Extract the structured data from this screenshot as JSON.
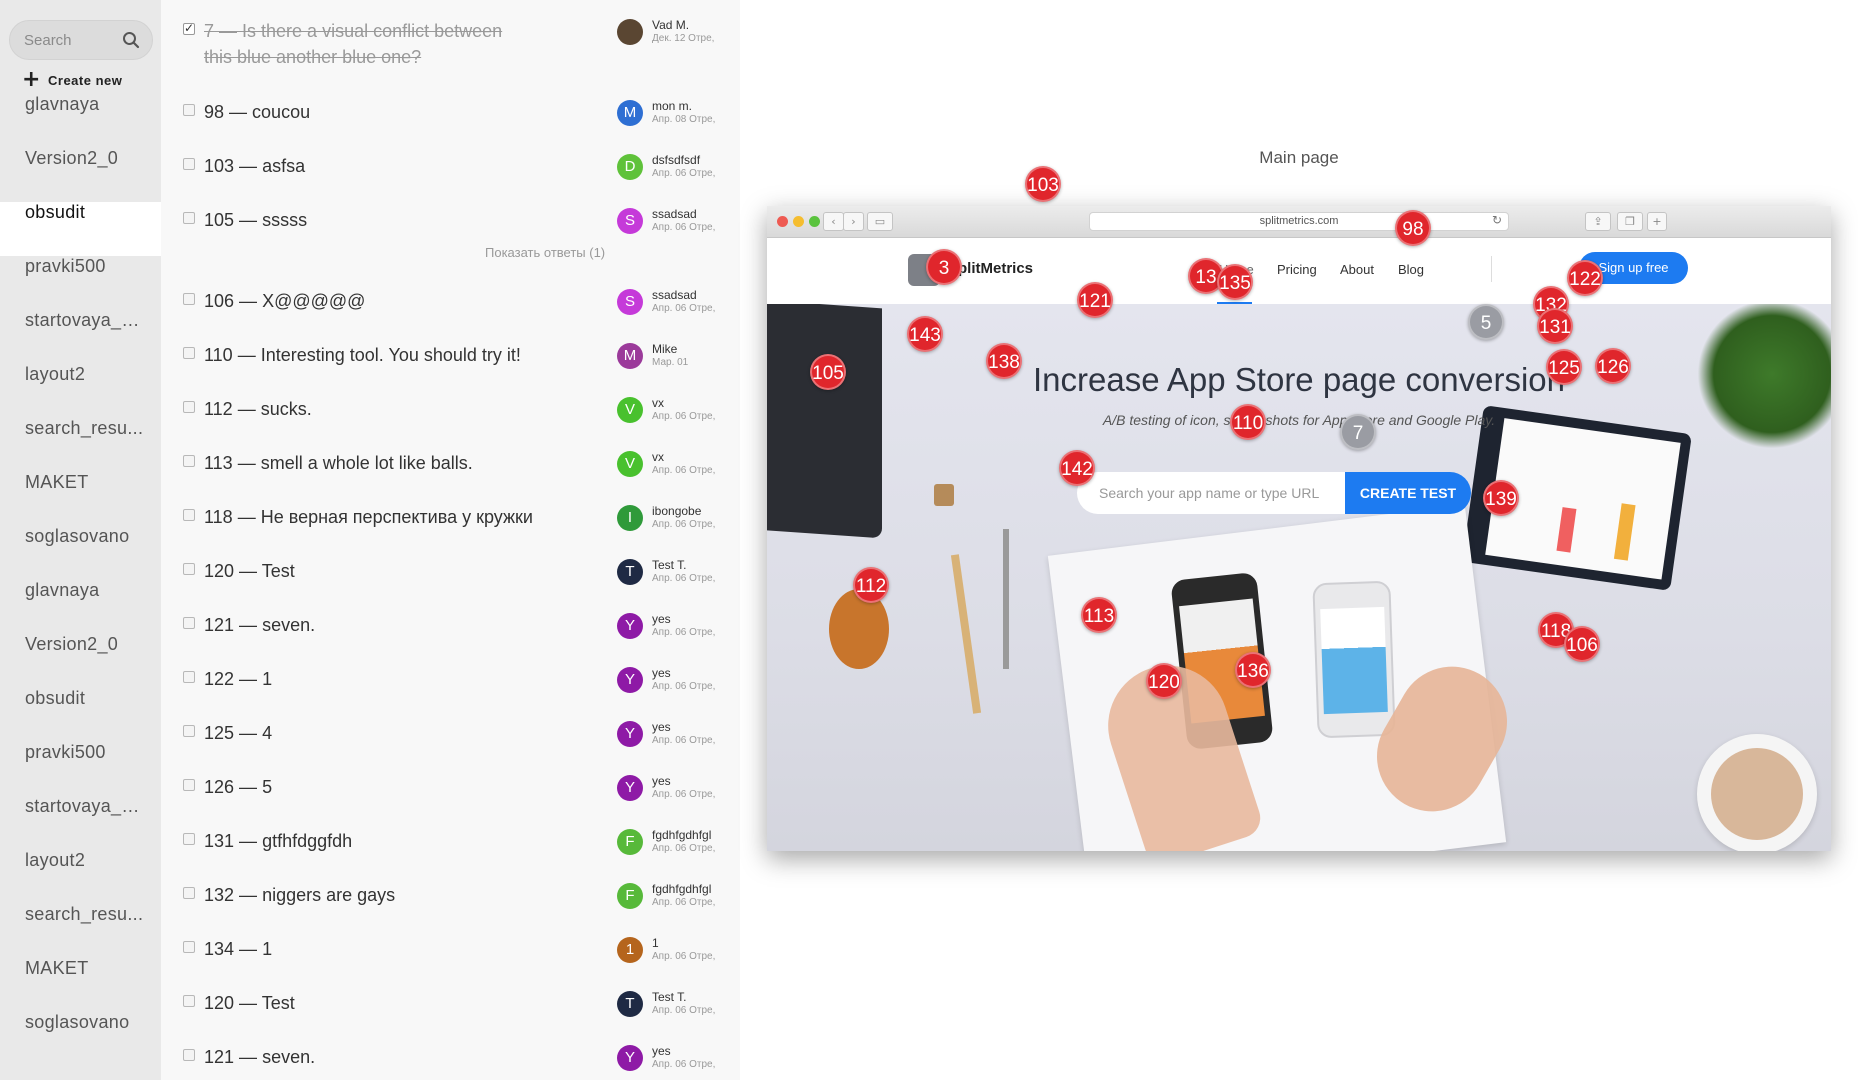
{
  "sidebar": {
    "search_placeholder": "Search",
    "create_new_label": "Create new",
    "pages": [
      {
        "label": "glavnaya"
      },
      {
        "label": "Version2_0"
      },
      {
        "label": "obsudit",
        "active": true
      },
      {
        "label": "pravki500"
      },
      {
        "label": "startovaya_s..."
      },
      {
        "label": "layout2"
      },
      {
        "label": "search_resu..."
      },
      {
        "label": "MAKET"
      },
      {
        "label": "soglasovano"
      },
      {
        "label": "glavnaya"
      },
      {
        "label": "Version2_0"
      },
      {
        "label": "obsudit"
      },
      {
        "label": "pravki500"
      },
      {
        "label": "startovaya_s..."
      },
      {
        "label": "layout2"
      },
      {
        "label": "search_resu..."
      },
      {
        "label": "MAKET"
      },
      {
        "label": "soglasovano"
      }
    ]
  },
  "comments": {
    "show_replies_label": "Показать ответы (1)",
    "items": [
      {
        "num": "7",
        "text": "Is there a visual conflict between this blue another blue one?",
        "done": true,
        "initial": "",
        "author": "Vad M.",
        "date": "Дек. 12 Отре,",
        "color": "#5a4632"
      },
      {
        "num": "98",
        "text": "coucou",
        "done": false,
        "initial": "M",
        "author": "mon m.",
        "date": "Апр. 08 Отре,",
        "color": "#2e6fd3"
      },
      {
        "num": "103",
        "text": "asfsa",
        "done": false,
        "initial": "D",
        "author": "dsfsdfsdf",
        "date": "Апр. 06 Отре,",
        "color": "#5fc23a"
      },
      {
        "num": "105",
        "text": "sssss",
        "done": false,
        "initial": "S",
        "author": "ssadsad",
        "date": "Апр. 06 Отре,",
        "color": "#c53ad9"
      },
      {
        "num": "106",
        "text": "X@@@@@",
        "done": false,
        "initial": "S",
        "author": "ssadsad",
        "date": "Апр. 06 Отре,",
        "color": "#c53ad9"
      },
      {
        "num": "110",
        "text": "Interesting tool. You should try it!",
        "done": false,
        "initial": "M",
        "author": "Mike",
        "date": "Мар. 01",
        "color": "#9b3a9a"
      },
      {
        "num": "112",
        "text": "sucks.",
        "done": false,
        "initial": "V",
        "author": "vx",
        "date": "Апр. 06 Отре,",
        "color": "#49c12e"
      },
      {
        "num": "113",
        "text": "smell a whole lot like balls.",
        "done": false,
        "initial": "V",
        "author": "vx",
        "date": "Апр. 06 Отре,",
        "color": "#49c12e"
      },
      {
        "num": "118",
        "text": "Не верная перспектива у кружки",
        "done": false,
        "initial": "I",
        "author": "ibongobe",
        "date": "Апр. 06 Отре,",
        "color": "#2f9a3a"
      },
      {
        "num": "120",
        "text": "Test",
        "done": false,
        "initial": "T",
        "author": "Test T.",
        "date": "Апр. 06 Отре,",
        "color": "#1f2a44"
      },
      {
        "num": "121",
        "text": "seven.",
        "done": false,
        "initial": "Y",
        "author": "yes",
        "date": "Апр. 06 Отре,",
        "color": "#8e1aa6"
      },
      {
        "num": "122",
        "text": "1",
        "done": false,
        "initial": "Y",
        "author": "yes",
        "date": "Апр. 06 Отре,",
        "color": "#8e1aa6"
      },
      {
        "num": "125",
        "text": "4",
        "done": false,
        "initial": "Y",
        "author": "yes",
        "date": "Апр. 06 Отре,",
        "color": "#8e1aa6"
      },
      {
        "num": "126",
        "text": "5",
        "done": false,
        "initial": "Y",
        "author": "yes",
        "date": "Апр. 06 Отре,",
        "color": "#8e1aa6"
      },
      {
        "num": "131",
        "text": "gtfhfdggfdh",
        "done": false,
        "initial": "F",
        "author": "fgdhfgdhfgl",
        "date": "Апр. 06 Отре,",
        "color": "#57b93a"
      },
      {
        "num": "132",
        "text": "niggers are gays",
        "done": false,
        "initial": "F",
        "author": "fgdhfgdhfgl",
        "date": "Апр. 06 Отре,",
        "color": "#57b93a"
      },
      {
        "num": "134",
        "text": "1",
        "done": false,
        "initial": "1",
        "author": "1",
        "date": "Апр. 06 Отре,",
        "color": "#b5651d"
      },
      {
        "num": "120",
        "text": "Test",
        "done": false,
        "initial": "T",
        "author": "Test T.",
        "date": "Апр. 06 Отре,",
        "color": "#1f2a44"
      },
      {
        "num": "121",
        "text": "seven.",
        "done": false,
        "initial": "Y",
        "author": "yes",
        "date": "Апр. 06 Отре,",
        "color": "#8e1aa6"
      }
    ]
  },
  "main": {
    "page_title": "Main page",
    "browser": {
      "url": "splitmetrics.com"
    },
    "site": {
      "logo_text": "SplitMetrics",
      "nav": [
        "Home",
        "Pricing",
        "About",
        "Blog"
      ],
      "signup_label": "Sign up free",
      "hero_title": "Increase App Store page conversion",
      "hero_subtitle": "A/B testing of icon, screenshots for App Store and Google Play.",
      "search_placeholder": "Search your app name or type URL",
      "create_test_label": "CREATE TEST"
    },
    "pins": [
      {
        "label": "103",
        "style": "red"
      },
      {
        "label": "98",
        "style": "red"
      },
      {
        "label": "3",
        "style": "red"
      },
      {
        "label": "13",
        "style": "red"
      },
      {
        "label": "135",
        "style": "red"
      },
      {
        "label": "121",
        "style": "red"
      },
      {
        "label": "122",
        "style": "red"
      },
      {
        "label": "132",
        "style": "red"
      },
      {
        "label": "131",
        "style": "red"
      },
      {
        "label": "5",
        "style": "grey"
      },
      {
        "label": "143",
        "style": "red"
      },
      {
        "label": "138",
        "style": "red"
      },
      {
        "label": "105",
        "style": "red"
      },
      {
        "label": "125",
        "style": "red"
      },
      {
        "label": "126",
        "style": "red"
      },
      {
        "label": "110",
        "style": "red"
      },
      {
        "label": "7",
        "style": "grey"
      },
      {
        "label": "142",
        "style": "red"
      },
      {
        "label": "139",
        "style": "red"
      },
      {
        "label": "112",
        "style": "red"
      },
      {
        "label": "113",
        "style": "red"
      },
      {
        "label": "118",
        "style": "red"
      },
      {
        "label": "106",
        "style": "red"
      },
      {
        "label": "136",
        "style": "red"
      },
      {
        "label": "120",
        "style": "red"
      }
    ]
  }
}
